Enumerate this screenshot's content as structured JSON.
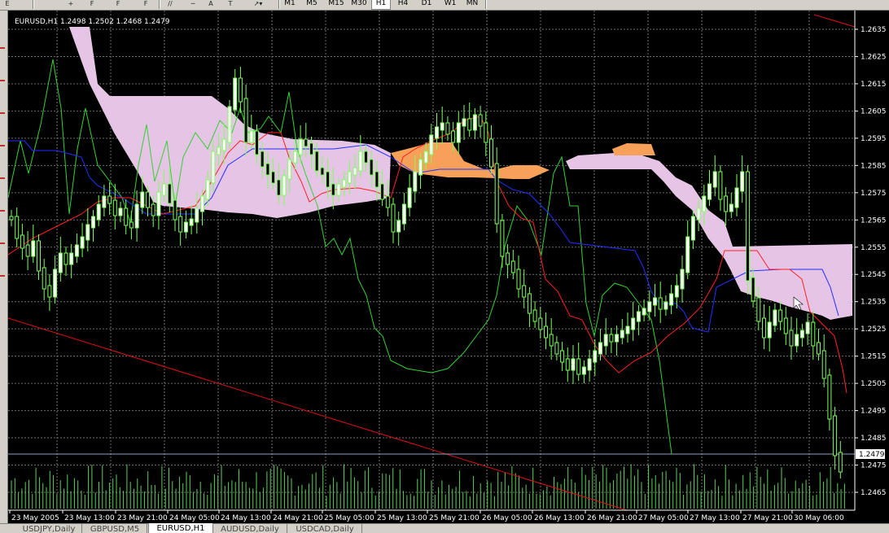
{
  "toolbar": {
    "icons": [
      "E",
      "",
      "F",
      "F",
      "A",
      "",
      "",
      "",
      "",
      "",
      ""
    ],
    "timeframes": [
      {
        "label": "M1",
        "active": false
      },
      {
        "label": "M5",
        "active": false
      },
      {
        "label": "M15",
        "active": false
      },
      {
        "label": "M30",
        "active": false
      },
      {
        "label": "H1",
        "active": true
      },
      {
        "label": "H4",
        "active": false
      },
      {
        "label": "D1",
        "active": false
      },
      {
        "label": "W1",
        "active": false
      },
      {
        "label": "MN",
        "active": false
      }
    ]
  },
  "chart": {
    "header": "EURUSD,H1  1.2498 1.2502 1.2468 1.2479",
    "current_price": "1.2479",
    "price_labels": [
      "1.2635",
      "1.2625",
      "1.2615",
      "1.2605",
      "1.2595",
      "1.2585",
      "1.2575",
      "1.2565",
      "1.2555",
      "1.2545",
      "1.2535",
      "1.2525",
      "1.2515",
      "1.2505",
      "1.2495",
      "1.2485",
      "1.2475",
      "1.2465"
    ],
    "time_labels": [
      "23 May 2005",
      "23 May 13:00",
      "23 May 21:00",
      "24 May 05:00",
      "24 May 13:00",
      "24 May 21:00",
      "25 May 05:00",
      "25 May 13:00",
      "25 May 21:00",
      "26 May 05:00",
      "26 May 13:00",
      "26 May 21:00",
      "27 May 05:00",
      "27 May 13:00",
      "27 May 21:00",
      "30 May 06:00"
    ],
    "colors": {
      "background": "#000000",
      "grid": "#7a7a7a",
      "axis_text": "#ffffff",
      "candle": "#7cff5a",
      "chikou": "#32d232",
      "tenkan": "#ff2020",
      "kijun": "#2030ff",
      "cloud_bear": "#e6c4e6",
      "cloud_bull": "#f7a05a",
      "trendline": "#e01010",
      "bid_line": "#8aa0c8",
      "volume": "#5cd05c"
    }
  },
  "tabs": [
    {
      "label": "USDJPY,Daily",
      "active": false
    },
    {
      "label": "GBPUSD,M5",
      "active": false
    },
    {
      "label": "EURUSD,H1",
      "active": true
    },
    {
      "label": "AUDUSD,Daily",
      "active": false
    },
    {
      "label": "USDCAD,Daily",
      "active": false
    }
  ]
}
